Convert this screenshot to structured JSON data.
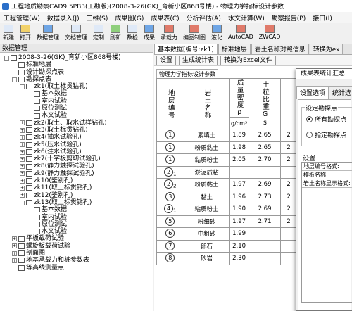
{
  "window": {
    "title": "工程地质勘察CAD9.5PB3(工勘版)(2008-3-26(GK)_育新小区868号楼) - 物理力学指标设计参数"
  },
  "menu": [
    "工程管理(W)",
    "数据录入(J)",
    "三维(S)",
    "成果图(G)",
    "成果表(C)",
    "分析评估(A)",
    "水文计算(W)",
    "勘察报告(P)",
    "接口(I)"
  ],
  "toolbar": [
    "新建",
    "打开",
    "数据管理",
    "文档管理",
    "定制",
    "刷新",
    "数检",
    "成果",
    "承载力",
    "编图制图",
    "液化",
    "AutoCAD",
    "ZWCAD"
  ],
  "left_pane": {
    "title": "数据管理",
    "tree": [
      {
        "label": "2008-3-26(GK)_育新小区868号楼)",
        "level": 0,
        "exp": "-"
      },
      {
        "label": "标准地层",
        "level": 1,
        "exp": ""
      },
      {
        "label": "设计勘探点表",
        "level": 1,
        "exp": ""
      },
      {
        "label": "勘探点表",
        "level": 1,
        "exp": "-"
      },
      {
        "label": "zk1(取土标贯钻孔)",
        "level": 2,
        "exp": "-"
      },
      {
        "label": "基本数据",
        "level": 3,
        "exp": ""
      },
      {
        "label": "室内试验",
        "level": 3,
        "exp": ""
      },
      {
        "label": "原位测试",
        "level": 3,
        "exp": ""
      },
      {
        "label": "水文试验",
        "level": 3,
        "exp": ""
      },
      {
        "label": "zk2(取土、取水试样钻孔)",
        "level": 2,
        "exp": "+"
      },
      {
        "label": "zk3(取土标贯钻孔)",
        "level": 2,
        "exp": "+"
      },
      {
        "label": "zk4(抽水试验孔)",
        "level": 2,
        "exp": "+"
      },
      {
        "label": "zk5(压水试验孔)",
        "level": 2,
        "exp": "+"
      },
      {
        "label": "zk6(注水试验孔)",
        "level": 2,
        "exp": "+"
      },
      {
        "label": "zk7(十字板剪切试验孔)",
        "level": 2,
        "exp": "+"
      },
      {
        "label": "zk8(静力触探试验孔)",
        "level": 2,
        "exp": "+"
      },
      {
        "label": "zk9(静力触探试验孔)",
        "level": 2,
        "exp": "+"
      },
      {
        "label": "zk10(鉴别孔)",
        "level": 2,
        "exp": "+"
      },
      {
        "label": "zk11(取土标贯钻孔)",
        "level": 2,
        "exp": "+"
      },
      {
        "label": "zk12(鉴别孔)",
        "level": 2,
        "exp": "+"
      },
      {
        "label": "zk13(取土标贯钻孔)",
        "level": 2,
        "exp": "-"
      },
      {
        "label": "基本数据",
        "level": 3,
        "exp": ""
      },
      {
        "label": "室内试验",
        "level": 3,
        "exp": ""
      },
      {
        "label": "原位测试",
        "level": 3,
        "exp": ""
      },
      {
        "label": "水文试验",
        "level": 3,
        "exp": ""
      },
      {
        "label": "平板载荷试验",
        "level": 1,
        "exp": "+"
      },
      {
        "label": "螺旋板载荷试验",
        "level": 1,
        "exp": "+"
      },
      {
        "label": "剖面图",
        "level": 1,
        "exp": "+"
      },
      {
        "label": "地基承载力和桩参数表",
        "level": 1,
        "exp": "+"
      },
      {
        "label": "等高线测量点",
        "level": 1,
        "exp": ""
      }
    ]
  },
  "doc_tabs": [
    "基本数据[编号:zk1]",
    "标准地层",
    "岩土名称对照信息",
    "转换为ex"
  ],
  "sub_toolbar": [
    "设置",
    "生成统计表",
    "转换为Excel文件"
  ],
  "grid_tab": "物理力学指标设计参数",
  "grid": {
    "headers": [
      "地层编号",
      "岩土名称",
      "质量密度ρ",
      "土粒比重Gs"
    ],
    "density_unit": "g/cm³",
    "rows": [
      {
        "no": "1",
        "sub": "",
        "name": "素填土",
        "rho": "1.89",
        "gs": "2.65",
        "x": "2"
      },
      {
        "no": "1",
        "sub": "",
        "name": "粉质黏土",
        "rho": "1.98",
        "gs": "2.65",
        "x": "2"
      },
      {
        "no": "1",
        "sub": "",
        "name": "黏质粉土",
        "rho": "2.05",
        "gs": "2.70",
        "x": "2"
      },
      {
        "no": "2",
        "sub": "1",
        "name": "淤泥质粘",
        "rho": "",
        "gs": "",
        "x": ""
      },
      {
        "no": "2",
        "sub": "2",
        "name": "粉质黏土",
        "rho": "1.97",
        "gs": "2.69",
        "x": "2"
      },
      {
        "no": "3",
        "sub": "",
        "name": "黏土",
        "rho": "1.96",
        "gs": "2.73",
        "x": "2"
      },
      {
        "no": "4",
        "sub": "1",
        "name": "粘质粉土",
        "rho": "1.90",
        "gs": "2.69",
        "x": "2"
      },
      {
        "no": "5",
        "sub": "",
        "name": "粉细砂",
        "rho": "1.97",
        "gs": "2.71",
        "x": "2"
      },
      {
        "no": "6",
        "sub": "",
        "name": "中粗砂",
        "rho": "1.99",
        "gs": "",
        "x": ""
      },
      {
        "no": "7",
        "sub": "",
        "name": "卵石",
        "rho": "2.10",
        "gs": "",
        "x": ""
      },
      {
        "no": "8",
        "sub": "",
        "name": "砂岩",
        "rho": "2.30",
        "gs": "",
        "x": ""
      }
    ]
  },
  "dialog": {
    "title": "成果表统计汇总",
    "tabs": [
      "设置选项",
      "统计选"
    ],
    "group_label": "设定勘探点",
    "radio_all": "所有勘探点",
    "radio_specific": "指定勘探点",
    "settings_label": "设置",
    "settings_rows": [
      "地层编号格式:",
      "模板名称",
      "岩土名称显示格式:"
    ]
  }
}
